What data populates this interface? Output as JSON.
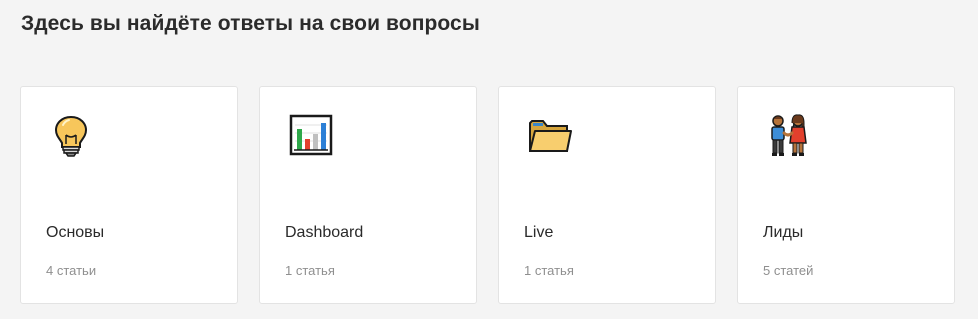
{
  "page": {
    "heading": "Здесь вы найдёте ответы на свои вопросы"
  },
  "cards": [
    {
      "icon": "lightbulb-icon",
      "title": "Основы",
      "count": "4 статьи"
    },
    {
      "icon": "bar-chart-icon",
      "title": "Dashboard",
      "count": "1 статья"
    },
    {
      "icon": "folder-icon",
      "title": "Live",
      "count": "1 статья"
    },
    {
      "icon": "people-holding-hands-icon",
      "title": "Лиды",
      "count": "5 статей"
    }
  ]
}
